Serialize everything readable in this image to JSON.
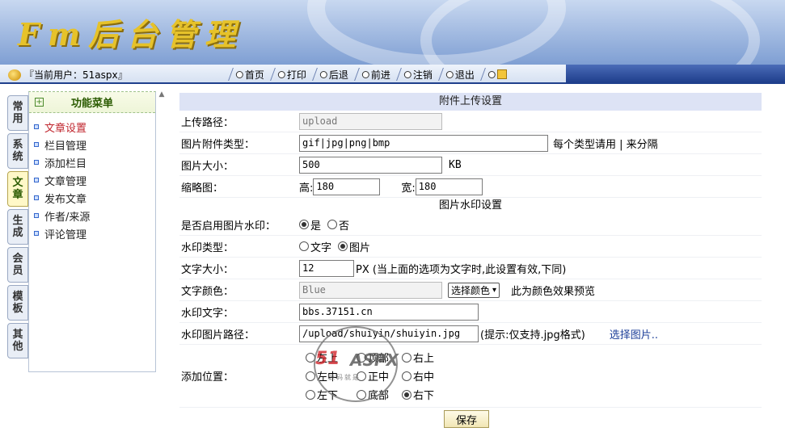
{
  "banner": {
    "logo_text": "Fm后台管理"
  },
  "navbar": {
    "current_user": "『当前用户：51aspx』",
    "items": [
      {
        "label": "首页",
        "icon": "circle-icon"
      },
      {
        "label": "打印",
        "icon": "circle-icon"
      },
      {
        "label": "后退",
        "icon": "circle-icon"
      },
      {
        "label": "前进",
        "icon": "circle-icon"
      },
      {
        "label": "注销",
        "icon": "circle-icon"
      },
      {
        "label": "退出",
        "icon": "circle-icon"
      },
      {
        "label": "",
        "icon": "circle-icon"
      }
    ]
  },
  "side_tabs": [
    "常用",
    "系统",
    "文章",
    "生成",
    "会员",
    "模板",
    "其他"
  ],
  "menu": {
    "title": "功能菜单",
    "items": [
      "文章设置",
      "栏目管理",
      "添加栏目",
      "文章管理",
      "发布文章",
      "作者/来源",
      "评论管理"
    ]
  },
  "form": {
    "title": "附件上传设置",
    "upload_path": {
      "label": "上传路径：",
      "value": "upload"
    },
    "image_types": {
      "label": "图片附件类型：",
      "value": "gif|jpg|png|bmp",
      "hint": "每个类型请用 | 来分隔"
    },
    "image_size": {
      "label": "图片大小：",
      "value": "500",
      "unit": "KB"
    },
    "thumbnail": {
      "label": "缩略图：",
      "height_label": "高:",
      "height_value": "180",
      "width_label": "宽:",
      "width_value": "180"
    },
    "watermark_title": "图片水印设置",
    "enable_watermark": {
      "label": "是否启用图片水印：",
      "options": [
        "是",
        "否"
      ]
    },
    "watermark_type": {
      "label": "水印类型：",
      "options": [
        "文字",
        "图片"
      ]
    },
    "text_size": {
      "label": "文字大小：",
      "value": "12",
      "hint": "PX (当上面的选项为文字时,此设置有效,下同)"
    },
    "text_color": {
      "label": "文字颜色：",
      "value": "Blue",
      "select": "选择颜色",
      "hint": "此为颜色效果预览"
    },
    "watermark_text": {
      "label": "水印文字：",
      "value": "bbs.37151.cn"
    },
    "watermark_image": {
      "label": "水印图片路径：",
      "value": "/upload/shuiyin/shuiyin.jpg",
      "hint": "(提示:仅支持.jpg格式)",
      "link": "选择图片.."
    },
    "position": {
      "label": "添加位置：",
      "options": [
        [
          "左上",
          "顶部",
          "右上"
        ],
        [
          "左中",
          "正中",
          "右中"
        ],
        [
          "左下",
          "底部",
          "右下"
        ]
      ]
    },
    "save_label": "保存"
  },
  "watermark_overlay": {
    "brand_red": "51",
    "brand_gray": "ASPX",
    "sub": "源码就是"
  }
}
